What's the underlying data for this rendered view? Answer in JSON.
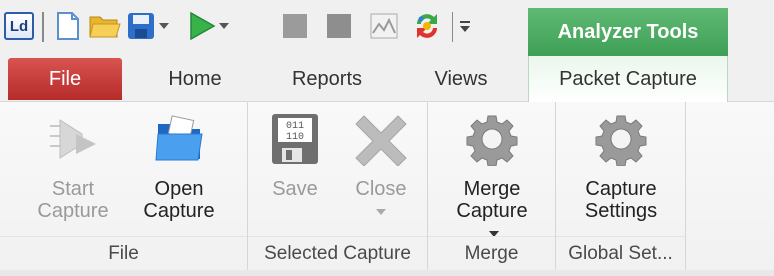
{
  "qat": {
    "logo_text": "Ld",
    "icons": [
      "new-document-icon",
      "open-folder-icon",
      "save-icon",
      "play-icon",
      "stop-square-icon",
      "stop-square-icon",
      "chart-icon",
      "refresh-arrows-icon",
      "customize-toolbar-icon"
    ]
  },
  "context_tab": {
    "header": "Analyzer Tools",
    "color": "#4aa860"
  },
  "tabs": {
    "file": "File",
    "home": "Home",
    "reports": "Reports",
    "views": "Views",
    "packet_capture": "Packet Capture"
  },
  "ribbon": {
    "groups": [
      {
        "label": "File",
        "buttons": [
          {
            "line1": "Start",
            "line2": "Capture",
            "enabled": false,
            "icon": "start-capture-icon"
          },
          {
            "line1": "Open",
            "line2": "Capture",
            "enabled": true,
            "icon": "open-folder-icon"
          }
        ]
      },
      {
        "label": "Selected Capture",
        "buttons": [
          {
            "line1": "Save",
            "line2": "",
            "enabled": false,
            "icon": "binary-save-icon"
          },
          {
            "line1": "Close",
            "line2": "",
            "enabled": false,
            "icon": "close-x-icon"
          }
        ]
      },
      {
        "label": "Merge",
        "buttons": [
          {
            "line1": "Merge",
            "line2": "Capture",
            "enabled": true,
            "icon": "gear-icon"
          }
        ]
      },
      {
        "label": "Global Set...",
        "buttons": [
          {
            "line1": "Capture",
            "line2": "Settings",
            "enabled": true,
            "icon": "gear-icon"
          }
        ]
      }
    ],
    "binary_icon_text": [
      "011",
      "110"
    ]
  },
  "colors": {
    "file_tab": "#c7403d",
    "context_green": "#4aa860",
    "folder_blue": "#2f7fd6"
  }
}
